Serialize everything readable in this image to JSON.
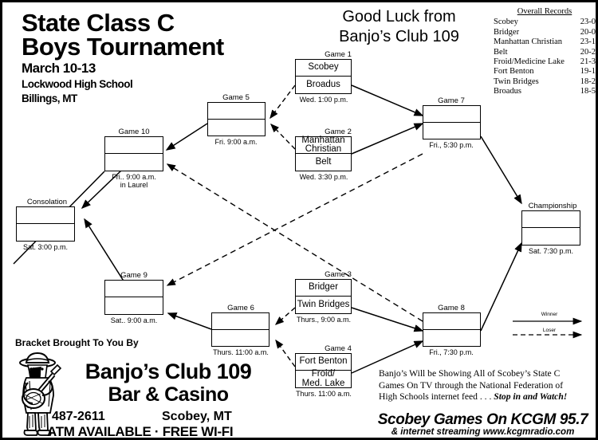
{
  "header": {
    "title_line1": "State  Class C",
    "title_line2": "Boys Tournament",
    "dates": "March 10-13",
    "venue": "Lockwood High School",
    "city": "Billings, MT",
    "good_luck_line1": "Good Luck from",
    "good_luck_line2": "Banjo’s Club 109"
  },
  "records": {
    "heading": "Overall Records",
    "rows": [
      {
        "team": "Scobey",
        "record": "23-0"
      },
      {
        "team": "Bridger",
        "record": "20-0"
      },
      {
        "team": "Manhattan Christian",
        "record": "23-1"
      },
      {
        "team": "Belt",
        "record": "20-2"
      },
      {
        "team": "Froid/Medicine Lake",
        "record": "21-3"
      },
      {
        "team": "Fort Benton",
        "record": "19-1"
      },
      {
        "team": "Twin Bridges",
        "record": "18-2"
      },
      {
        "team": "Broadus",
        "record": "18-5"
      }
    ]
  },
  "bracket": {
    "game1": {
      "label": "Game 1",
      "top": "Scobey",
      "bottom": "Broadus",
      "time": "Wed. 1:00 p.m."
    },
    "game2": {
      "label": "Game 2",
      "top_line1": "Manhattan",
      "top_line2": "Christian",
      "bottom": "Belt",
      "time": "Wed. 3:30 p.m."
    },
    "game3": {
      "label": "Game 3",
      "top": "Bridger",
      "bottom": "Twin Bridges",
      "time": "Thurs., 9:00 a.m."
    },
    "game4": {
      "label": "Game 4",
      "top": "Fort Benton",
      "bottom_line1": "Froid/",
      "bottom_line2": "Med. Lake",
      "time": "Thurs. 11:00 a.m."
    },
    "game5": {
      "label": "Game 5",
      "top": "",
      "bottom": "",
      "time": "Fri. 9:00 a.m."
    },
    "game6": {
      "label": "Game 6",
      "top": "",
      "bottom": "",
      "time": "Thurs. 11:00 a.m."
    },
    "game7": {
      "label": "Game 7",
      "top": "",
      "bottom": "",
      "time": "Fri., 5:30 p.m."
    },
    "game8": {
      "label": "Game 8",
      "top": "",
      "bottom": "",
      "time": "Fri., 7:30 p.m."
    },
    "game9": {
      "label": "Game 9",
      "top": "",
      "bottom": "",
      "time": "Sat.. 9:00 a.m."
    },
    "game10": {
      "label": "Game 10",
      "top": "",
      "bottom": "",
      "time_line1": "Fri.. 9:00 a.m.",
      "time_line2": "in Laurel"
    },
    "consolation": {
      "label": "Consolation",
      "top": "",
      "bottom": "",
      "time": "Sat. 3:00 p.m."
    },
    "championship": {
      "label": "Championship",
      "top": "",
      "bottom": "",
      "time": "Sat. 7:30 p.m."
    }
  },
  "legend": {
    "winner": "Winner",
    "loser": "Loser"
  },
  "sponsor": {
    "brought_by": "Bracket Brought To You By",
    "name": "Banjo’s Club 109",
    "subtitle": "Bar & Casino",
    "phone": "487-2611",
    "town": "Scobey, MT",
    "atm": "ATM AVAILABLE · FREE WI-FI"
  },
  "promo": {
    "line1": "Banjo’s Will be Showing All of Scobey’s State C",
    "line2": "Games On TV through the National Federation of",
    "line3": "High Schools internet feed . . . ",
    "line3_bold": "Stop in and Watch!",
    "radio": "Scobey Games On KCGM 95.7",
    "stream": "& internet streaming  www.kcgmradio.com"
  },
  "colors": {
    "ink": "#000000",
    "paper": "#ffffff"
  }
}
